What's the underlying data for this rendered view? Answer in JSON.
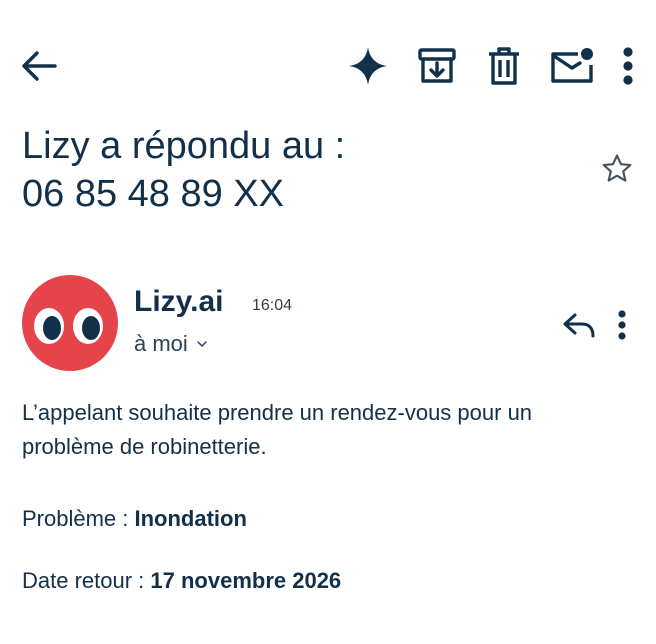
{
  "toolbar": {
    "back_icon": "arrow-left-icon",
    "gemini_icon": "sparkle-icon",
    "archive_icon": "archive-icon",
    "delete_icon": "trash-icon",
    "mark_unread_icon": "mail-unread-icon",
    "more_icon": "more-vertical-icon"
  },
  "email": {
    "subject_line1": "Lizy a répondu au :",
    "subject_line2": "06 85 48 89 XX",
    "starred": false,
    "sender": {
      "name": "Lizy.ai",
      "time": "16:04",
      "recipient": "à moi",
      "avatar_color": "#e5454a"
    },
    "body": "L’appelant souhaite prendre un rendez-vous pour un problème de robinetterie.",
    "fields": [
      {
        "label": "Problème : ",
        "value": "Inondation"
      },
      {
        "label": "Date retour : ",
        "value": "17 novembre 2026"
      }
    ]
  },
  "colors": {
    "text": "#13304a",
    "icon": "#13304a",
    "accent_red": "#e5454a"
  }
}
